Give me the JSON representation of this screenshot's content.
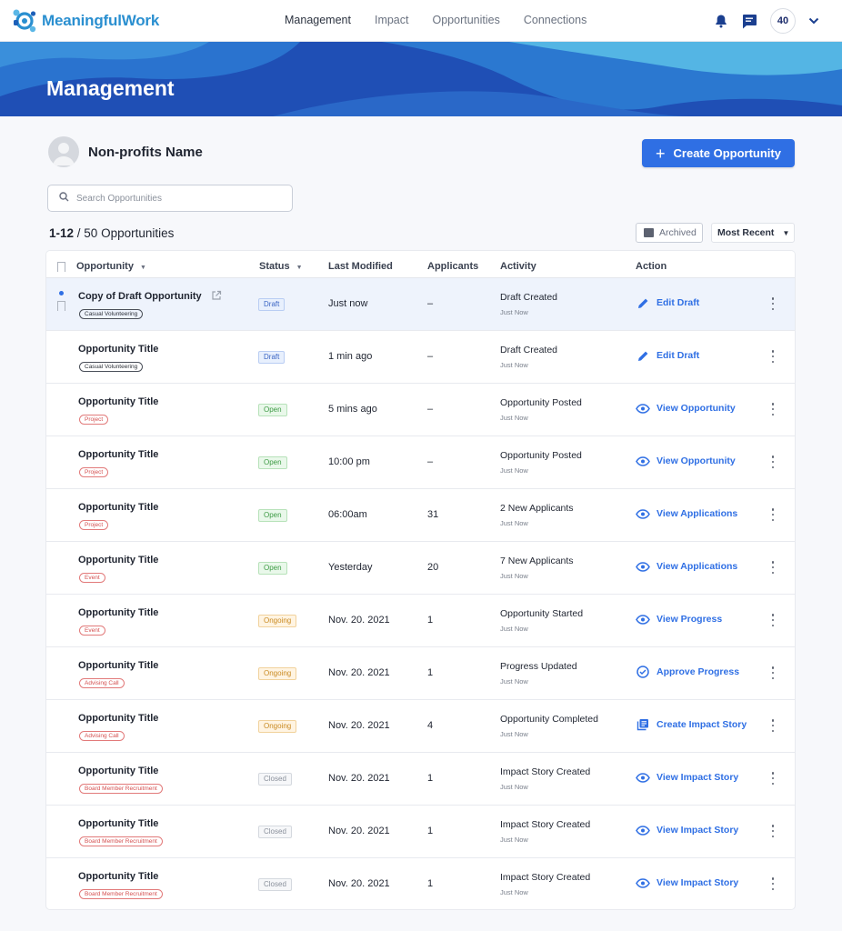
{
  "brand": {
    "name": "MeaningfulWork",
    "accent": "#2f6fe4"
  },
  "nav": {
    "links": [
      "Management",
      "Impact",
      "Opportunities",
      "Connections"
    ],
    "active": "Management",
    "badge": "40",
    "icons": [
      "bell-icon",
      "message-icon",
      "chevron-down-icon"
    ]
  },
  "hero": {
    "title": "Management"
  },
  "org": {
    "name": "Non-profits Name"
  },
  "create_button": {
    "label": "Create Opportunity"
  },
  "search": {
    "placeholder": "Search Opportunities"
  },
  "results": {
    "range": "1-12",
    "total": "/ 50 Opportunities"
  },
  "archived_label": "Archived",
  "sort_label": "Most Recent",
  "table": {
    "headers": {
      "opportunity": "Opportunity",
      "status": "Status",
      "modified": "Last Modified",
      "applicants": "Applicants",
      "activity": "Activity",
      "action": "Action"
    },
    "rows": [
      {
        "title": "Copy of Draft Opportunity",
        "tag": "Casual Volunteering",
        "tag_style": "casual",
        "status": "Draft",
        "status_style": "draft",
        "modified": "Just now",
        "applicants": "–",
        "activity": "Draft Created",
        "activity_time": "Just Now",
        "action": "Edit Draft",
        "action_icon": "pencil-icon"
      },
      {
        "title": "Opportunity Title",
        "tag": "Casual Volunteering",
        "tag_style": "casual",
        "status": "Draft",
        "status_style": "draft",
        "modified": "1 min ago",
        "applicants": "–",
        "activity": "Draft Created",
        "activity_time": "Just Now",
        "action": "Edit Draft",
        "action_icon": "pencil-icon"
      },
      {
        "title": "Opportunity Title",
        "tag": "Project",
        "tag_style": "red",
        "status": "Open",
        "status_style": "open",
        "modified": "5 mins ago",
        "applicants": "–",
        "activity": "Opportunity Posted",
        "activity_time": "Just Now",
        "action": "View Opportunity",
        "action_icon": "eye-icon"
      },
      {
        "title": "Opportunity Title",
        "tag": "Project",
        "tag_style": "red",
        "status": "Open",
        "status_style": "open",
        "modified": "10:00 pm",
        "applicants": "–",
        "activity": "Opportunity Posted",
        "activity_time": "Just Now",
        "action": "View Opportunity",
        "action_icon": "eye-icon"
      },
      {
        "title": "Opportunity Title",
        "tag": "Project",
        "tag_style": "red",
        "status": "Open",
        "status_style": "open",
        "modified": "06:00am",
        "applicants": "31",
        "activity": "2 New Applicants",
        "activity_time": "Just Now",
        "action": "View Applications",
        "action_icon": "eye-icon"
      },
      {
        "title": "Opportunity Title",
        "tag": "Event",
        "tag_style": "red",
        "status": "Open",
        "status_style": "open",
        "modified": "Yesterday",
        "applicants": "20",
        "activity": "7 New Applicants",
        "activity_time": "Just Now",
        "action": "View Applications",
        "action_icon": "eye-icon"
      },
      {
        "title": "Opportunity Title",
        "tag": "Event",
        "tag_style": "red",
        "status": "Ongoing",
        "status_style": "ongoing",
        "modified": "Nov. 20. 2021",
        "applicants": "1",
        "activity": "Opportunity Started",
        "activity_time": "Just Now",
        "action": "View Progress",
        "action_icon": "eye-icon"
      },
      {
        "title": "Opportunity Title",
        "tag": "Advising Call",
        "tag_style": "red",
        "status": "Ongoing",
        "status_style": "ongoing",
        "modified": "Nov. 20. 2021",
        "applicants": "1",
        "activity": "Progress Updated",
        "activity_time": "Just Now",
        "action": "Approve Progress",
        "action_icon": "check-circle-icon"
      },
      {
        "title": "Opportunity Title",
        "tag": "Advising Call",
        "tag_style": "red",
        "status": "Ongoing",
        "status_style": "ongoing",
        "modified": "Nov. 20. 2021",
        "applicants": "4",
        "activity": "Opportunity Completed",
        "activity_time": "Just Now",
        "action": "Create Impact Story",
        "action_icon": "library-icon"
      },
      {
        "title": "Opportunity Title",
        "tag": "Board Member Recruitment",
        "tag_style": "red",
        "status": "Closed",
        "status_style": "closed",
        "modified": "Nov. 20. 2021",
        "applicants": "1",
        "activity": "Impact Story Created",
        "activity_time": "Just Now",
        "action": "View Impact Story",
        "action_icon": "eye-icon"
      },
      {
        "title": "Opportunity Title",
        "tag": "Board Member Recruitment",
        "tag_style": "red",
        "status": "Closed",
        "status_style": "closed",
        "modified": "Nov. 20. 2021",
        "applicants": "1",
        "activity": "Impact Story Created",
        "activity_time": "Just Now",
        "action": "View Impact Story",
        "action_icon": "eye-icon"
      },
      {
        "title": "Opportunity Title",
        "tag": "Board Member Recruitment",
        "tag_style": "red",
        "status": "Closed",
        "status_style": "closed",
        "modified": "Nov. 20. 2021",
        "applicants": "1",
        "activity": "Impact Story Created",
        "activity_time": "Just Now",
        "action": "View Impact Story",
        "action_icon": "eye-icon"
      }
    ]
  }
}
